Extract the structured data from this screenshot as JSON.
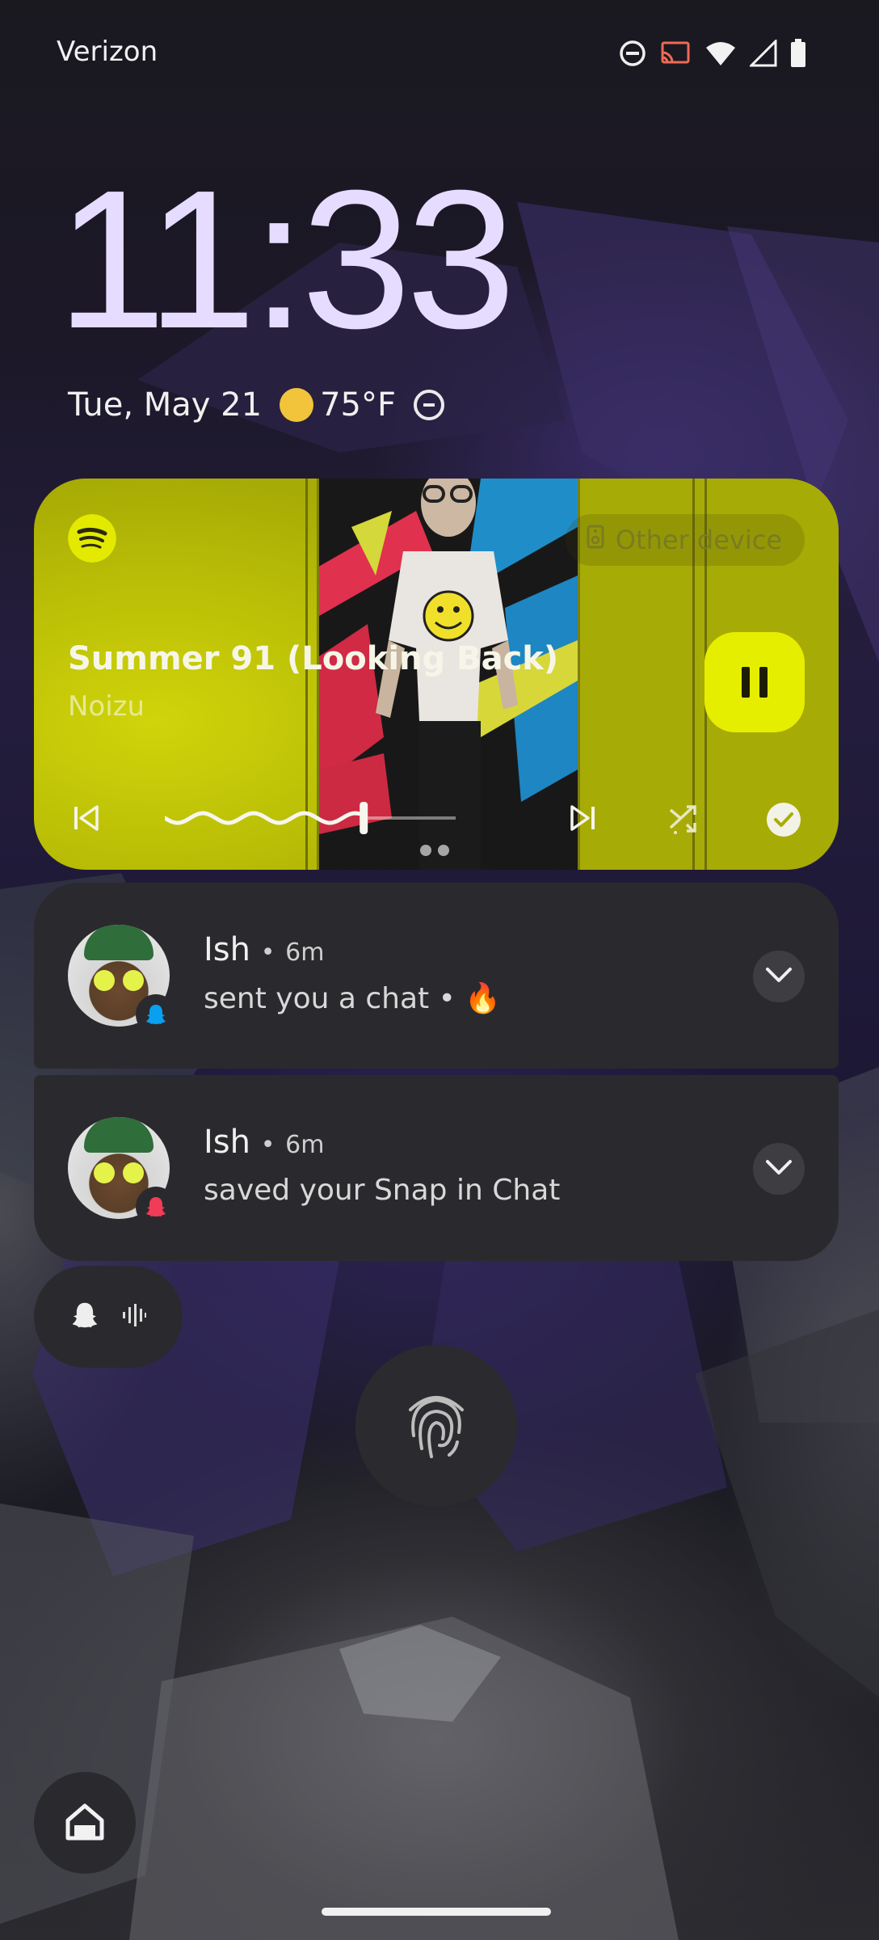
{
  "status_bar": {
    "carrier": "Verizon",
    "icons": [
      "do-not-disturb-icon",
      "cast-icon",
      "wifi-icon",
      "cell-signal-icon",
      "battery-icon"
    ]
  },
  "lockscreen": {
    "time": "11:33",
    "date": "Tue, May 21",
    "weather_icon": "sun-icon",
    "temperature": "75°F",
    "dnd_icon": "do-not-disturb-icon"
  },
  "media_player": {
    "app": "Spotify",
    "output_chip": "Other device",
    "title": "Summer 91 (Looking Back)",
    "artist": "Noizu",
    "progress": 0.67,
    "state": "playing",
    "accent_color": "#cdd20a",
    "controls": [
      "previous-icon",
      "pause-icon",
      "next-icon",
      "shuffle-icon",
      "check-icon"
    ]
  },
  "notifications": [
    {
      "sender": "Ish",
      "time": "6m",
      "separator": "•",
      "body": "sent you a chat • 🔥",
      "app_badge": "snapchat-icon",
      "badge_color": "#0aa0f0"
    },
    {
      "sender": "Ish",
      "time": "6m",
      "separator": "•",
      "body": "saved your Snap in Chat",
      "app_badge": "snapchat-icon",
      "badge_color": "#f23c57"
    }
  ],
  "overflow_pill": {
    "icons": [
      "snapchat-ghost-icon",
      "soundwave-icon"
    ]
  },
  "unlock": {
    "icon": "fingerprint-icon"
  },
  "shortcut": {
    "icon": "home-icon"
  }
}
